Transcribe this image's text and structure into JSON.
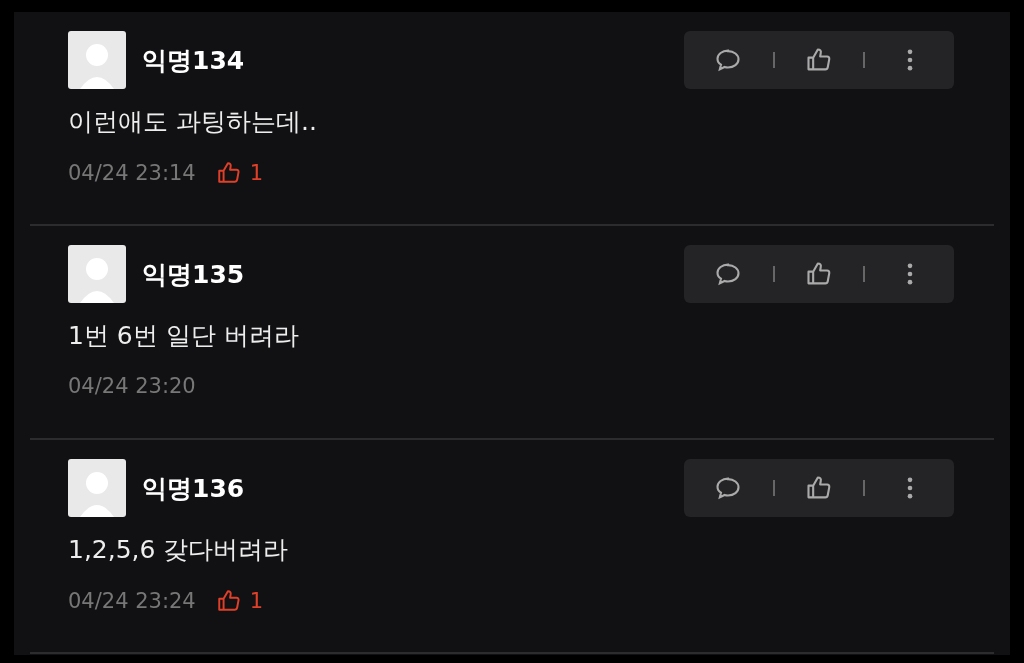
{
  "comments": [
    {
      "author": "익명134",
      "text": "이런애도 과팅하는데..",
      "time": "04/24 23:14",
      "likes": "1"
    },
    {
      "author": "익명135",
      "text": "1번 6번 일단 버려라",
      "time": "04/24 23:20"
    },
    {
      "author": "익명136",
      "text": "1,2,5,6 갖다버려라",
      "time": "04/24 23:24",
      "likes": "1"
    }
  ]
}
